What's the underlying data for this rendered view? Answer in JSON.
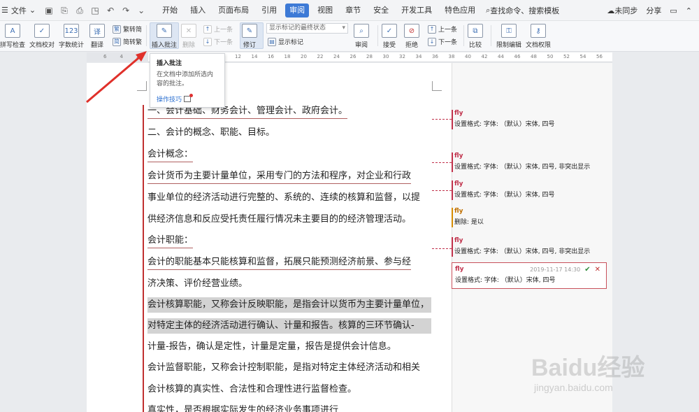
{
  "menubar": {
    "file_label": "文件",
    "menus": [
      "开始",
      "插入",
      "页面布局",
      "引用",
      "审阅",
      "视图",
      "章节",
      "安全",
      "开发工具",
      "特色应用"
    ],
    "active_menu": "审阅",
    "search": "查找命令、搜索模板",
    "sync": "未同步",
    "share": "分享"
  },
  "ribbon": {
    "spellcheck": "拼写检查",
    "doc_proof": "文档校对",
    "word_count": "字数统计",
    "translate": "翻译",
    "trad_to_simp": "繁转简",
    "simp_to_trad": "简转繁",
    "insert_comment": "插入批注",
    "delete": "删除",
    "prev": "上一条",
    "next": "下一条",
    "track": "修订",
    "markup_select": "显示标记的最终状态",
    "show_markup": "显示标记",
    "review": "审阅",
    "accept": "接受",
    "reject": "拒绝",
    "prev2": "上一条",
    "next2": "下一条",
    "compare": "比较",
    "restrict": "限制编辑",
    "permission": "文档权限"
  },
  "ruler": [
    "6",
    "4",
    "2",
    "2",
    "4",
    "6",
    "8",
    "10",
    "12",
    "14",
    "16",
    "18",
    "20",
    "22",
    "24",
    "26",
    "28",
    "30",
    "32",
    "34",
    "36",
    "38",
    "40",
    "42",
    "44",
    "46",
    "48",
    "50",
    "52",
    "54",
    "56"
  ],
  "tooltip": {
    "title": "插入批注",
    "desc": "在文档中添加所选内容的批注。",
    "link": "操作技巧"
  },
  "document": {
    "lines": [
      "一、会计基础、财务会计、管理会计、政府会计。",
      "二、会计的概念、职能、目标。",
      "会计概念：",
      "   会计货币为主要计量单位，采用专门的方法和程序，对企业和行政",
      "事业单位的经济活动进行完整的、系统的、连续的核算和监督，以提",
      "供经济信息和反应受托责任履行情况未主要目的的经济管理活动。",
      "会计职能：",
      "   会计的职能基本只能核算和监督，拓展只能预测经济前景、参与经",
      "济决策、评价经营业绩。",
      "会计核算职能，又称会计反映职能，是指会计以货币为主要计量单位，",
      "对特定主体的经济活动进行确认、计量和报告。核算的三环节确认-",
      "计量-报告，确认是定性，计量是定量，报告是提供会计信息。",
      "会计监督职能，又称会计控制职能，是指对特定主体经济活动和相关",
      "会计核算的真实性、合法性和合理性进行监督检查。",
      "真实性，是否根据实际发生的经济业务事项进行"
    ]
  },
  "comments": [
    {
      "author": "fly",
      "text": "设置格式: 字体: （默认）宋体, 四号"
    },
    {
      "author": "fly",
      "text": "设置格式: 字体: （默认）宋体, 四号, 非突出显示"
    },
    {
      "author": "fly",
      "text": "设置格式: 字体: （默认）宋体, 四号"
    },
    {
      "author": "fly",
      "text": "删除: 是以"
    },
    {
      "author": "fly",
      "text": "设置格式: 字体: （默认）宋体, 四号, 非突出显示"
    },
    {
      "author": "fly",
      "text": "设置格式: 字体: （默认）宋体, 四号",
      "time": "2019-11-17 14:30"
    }
  ],
  "watermark": {
    "logo": "Baidu经验",
    "url": "jingyan.baidu.com"
  },
  "colors": {
    "accent": "#3d7ad6",
    "comment": "#c0304a",
    "arrow": "#e0302a"
  }
}
